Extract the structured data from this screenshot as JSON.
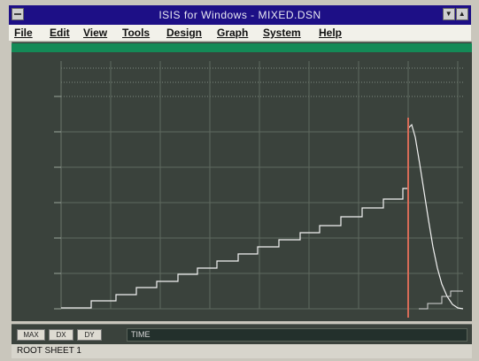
{
  "window": {
    "title": "ISIS for Windows - MIXED.DSN"
  },
  "menu": {
    "items": [
      "File",
      "Edit",
      "View",
      "Tools",
      "Design",
      "Graph",
      "System",
      "Help"
    ]
  },
  "graph": {
    "colors": {
      "background": "#3a423c",
      "trace": "#f2f2f2",
      "cursor": "#d66b57",
      "header": "#148a57"
    }
  },
  "bottombar": {
    "buttons": [
      "MAX",
      "DX",
      "DY"
    ],
    "time_label": "TIME"
  },
  "status": {
    "sheet": "ROOT SHEET 1"
  }
}
